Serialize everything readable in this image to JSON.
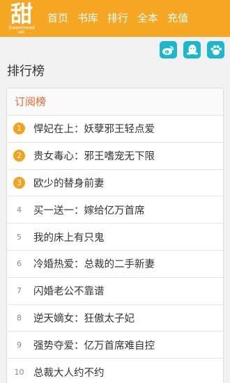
{
  "app": {
    "logo_char": "甜",
    "logo_sub1": "Sweetread",
    "logo_sub2": "ABC",
    "accent_color": "#f5a623",
    "rank_top_color": "#f3a21b"
  },
  "nav": {
    "items": [
      {
        "label": "首页"
      },
      {
        "label": "书库"
      },
      {
        "label": "排行"
      },
      {
        "label": "全本"
      },
      {
        "label": "充值"
      }
    ]
  },
  "share": {
    "icons": [
      "weibo-icon",
      "qq-icon",
      "paw-icon"
    ]
  },
  "page": {
    "title": "排行榜"
  },
  "ranking": {
    "section_title": "订阅榜",
    "items": [
      {
        "rank": "1",
        "name": "悍妃在上：妖孽邪王轻点爱"
      },
      {
        "rank": "2",
        "name": "贵女毒心：邪王嗜宠无下限"
      },
      {
        "rank": "3",
        "name": "欧少的替身前妻"
      },
      {
        "rank": "4",
        "name": "买一送一：嫁给亿万首席"
      },
      {
        "rank": "5",
        "name": "我的床上有只鬼"
      },
      {
        "rank": "6",
        "name": "冷婚热爱：总裁的二手新妻"
      },
      {
        "rank": "7",
        "name": "闪婚老公不靠谱"
      },
      {
        "rank": "8",
        "name": "逆天嫡女：狂傲太子妃"
      },
      {
        "rank": "9",
        "name": "强势夺爱：亿万首席难自控"
      },
      {
        "rank": "10",
        "name": "总裁大人约不约"
      }
    ]
  }
}
